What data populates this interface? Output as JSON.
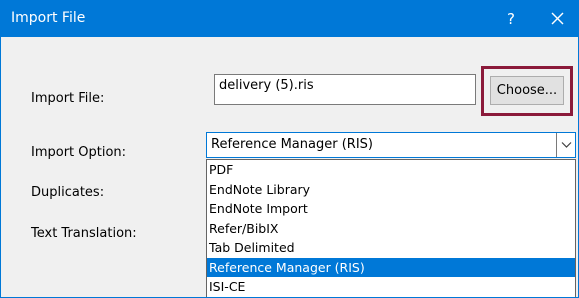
{
  "window": {
    "title": "Import File",
    "help_label": "?"
  },
  "form": {
    "import_file_label": "Import File:",
    "import_file_value": "delivery (5).ris",
    "choose_label": "Choose...",
    "import_option_label": "Import Option:",
    "import_option_value": "Reference Manager (RIS)",
    "duplicates_label": "Duplicates:",
    "text_translation_label": "Text Translation:"
  },
  "dropdown": {
    "options": [
      "PDF",
      "EndNote Library",
      "EndNote Import",
      "Refer/BibIX",
      "Tab Delimited",
      "Reference Manager (RIS)",
      "ISI-CE"
    ],
    "selected_index": 5
  },
  "colors": {
    "titlebar": "#0078d7",
    "highlight": "#8b1a3a",
    "selection": "#0078d7"
  },
  "icons": {
    "close": "close-icon",
    "dropdown_arrow": "chevron-down-icon"
  }
}
